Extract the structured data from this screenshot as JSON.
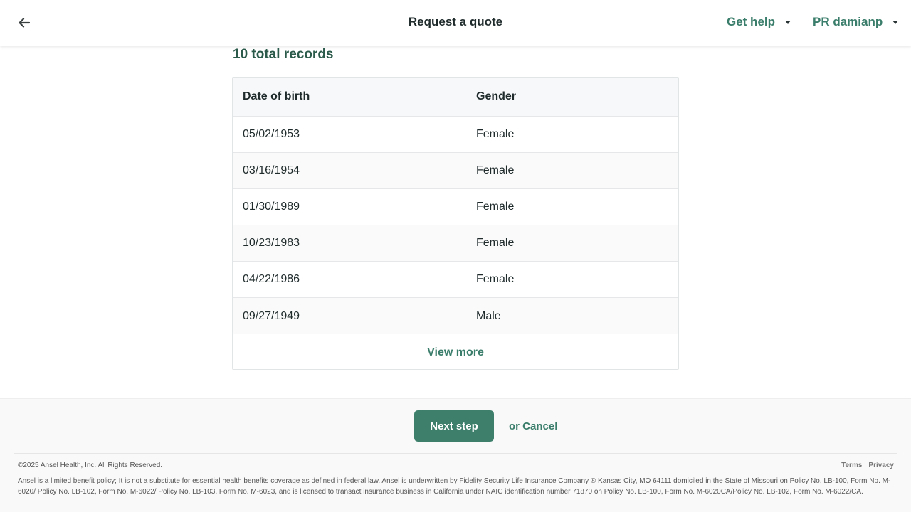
{
  "header": {
    "title": "Request a quote",
    "help_label": "Get help",
    "user_label": "PR damianp"
  },
  "records": {
    "title": "10 total records",
    "columns": [
      "Date of birth",
      "Gender"
    ],
    "rows": [
      {
        "dob": "05/02/1953",
        "gender": "Female"
      },
      {
        "dob": "03/16/1954",
        "gender": "Female"
      },
      {
        "dob": "01/30/1989",
        "gender": "Female"
      },
      {
        "dob": "10/23/1983",
        "gender": "Female"
      },
      {
        "dob": "04/22/1986",
        "gender": "Female"
      },
      {
        "dob": "09/27/1949",
        "gender": "Male"
      }
    ],
    "view_more_label": "View more"
  },
  "footer": {
    "next_label": "Next step",
    "cancel_label": "or Cancel",
    "copyright": "©2025 Ansel Health, Inc. All Rights Reserved.",
    "terms_label": "Terms",
    "privacy_label": "Privacy",
    "disclaimer": "Ansel is a limited benefit policy; It is not a substitute for essential health benefits coverage as defined in federal law. Ansel is underwritten by Fidelity Security Life Insurance Company ® Kansas City, MO 64111 domiciled in the State of Missouri on Policy No. LB-100, Form No. M-6020/ Policy No. LB-102, Form No. M-6022/ Policy No. LB-103, Form No. M-6023, and is licensed to transact insurance business in California under NAIC identification number 71870 on Policy No. LB-100, Form No. M-6020CA/Policy No. LB-102, Form No. M-6022/CA."
  },
  "colors": {
    "accent": "#3a7d6a",
    "button": "#3d7f6b",
    "title_green": "#2b5a4b"
  },
  "icons": {
    "back": "arrow-left-icon",
    "dropdown": "caret-down-icon"
  }
}
